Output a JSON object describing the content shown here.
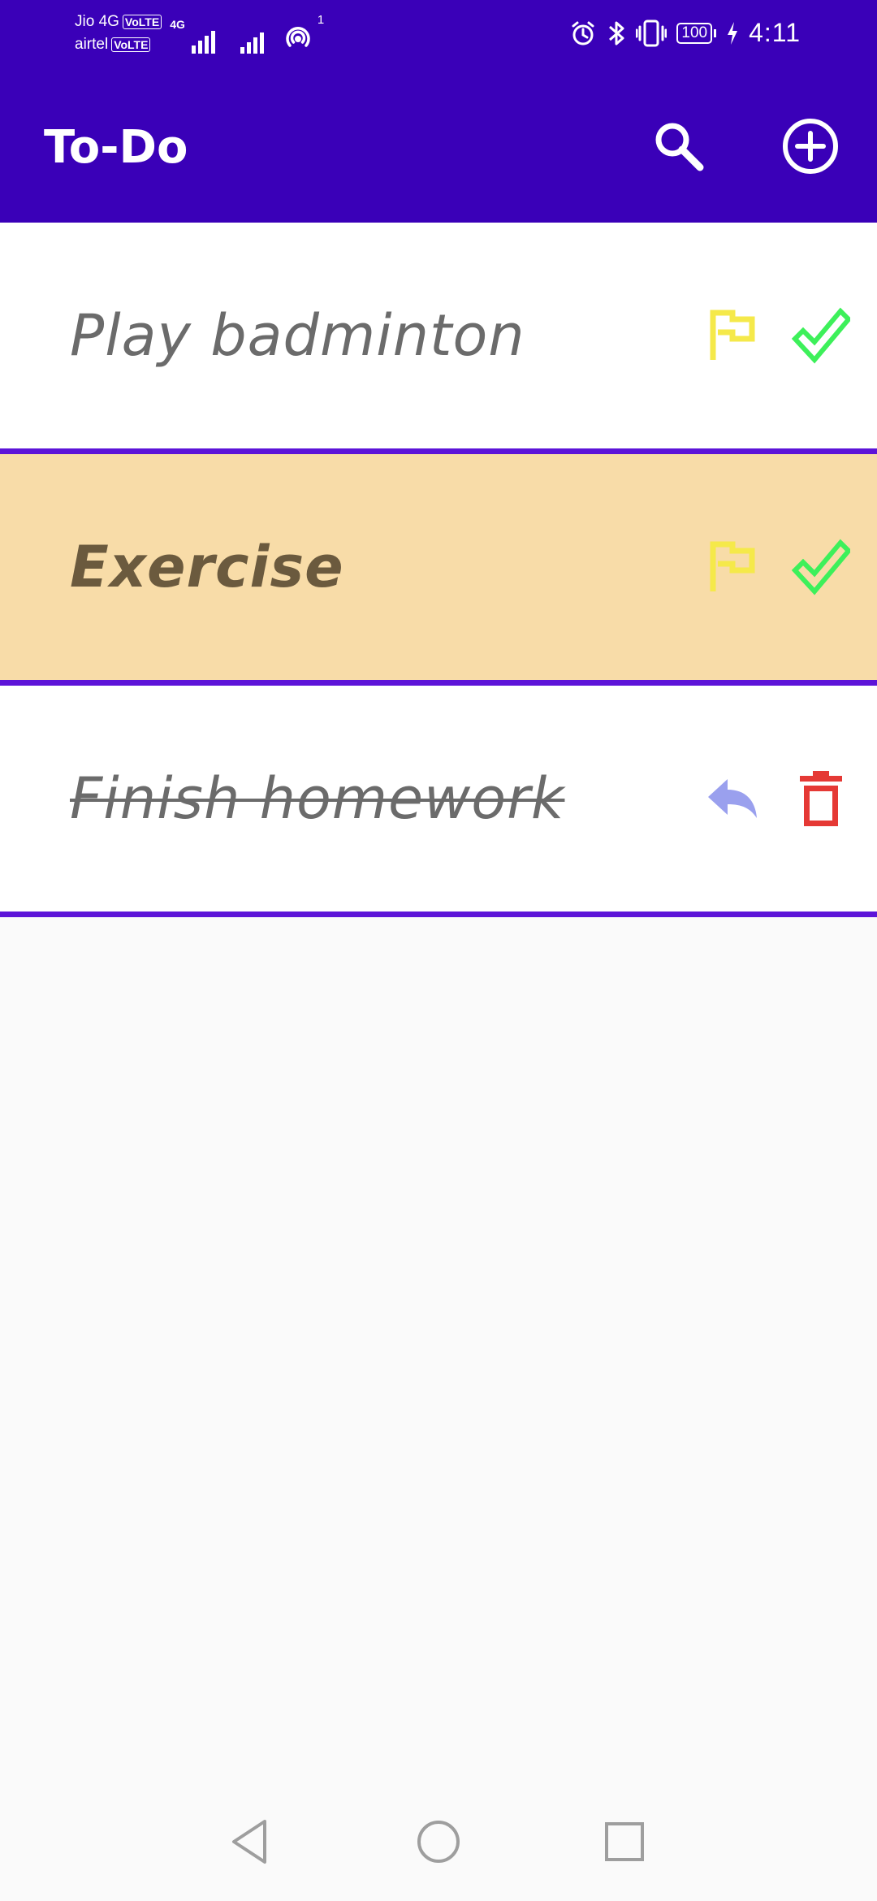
{
  "status_bar": {
    "carrier_1": "Jio 4G",
    "carrier_1_badge": "VoLTE",
    "carrier_2": "airtel",
    "carrier_2_badge": "VoLTE",
    "network_tag": "4G",
    "hotspot_count": "1",
    "battery_level": "100",
    "time": "4:11",
    "icons": [
      "alarm-icon",
      "bluetooth-icon",
      "vibrate-icon",
      "battery-icon",
      "charging-icon"
    ]
  },
  "app_bar": {
    "title": "To-Do",
    "background_color": "#3a00b8",
    "actions": [
      "search-icon",
      "add-circle-icon"
    ]
  },
  "tasks": [
    {
      "text": "Play badminton",
      "state": "pending",
      "highlighted": false,
      "actions": [
        "flag-icon",
        "check-icon"
      ]
    },
    {
      "text": "Exercise",
      "state": "pending",
      "highlighted": true,
      "actions": [
        "flag-icon",
        "check-icon"
      ]
    },
    {
      "text": "Finish homework",
      "state": "completed",
      "highlighted": false,
      "actions": [
        "undo-icon",
        "trash-icon"
      ]
    }
  ],
  "colors": {
    "divider": "#5d14d8",
    "highlight_row": "#f8dca8",
    "flag": "#f5e94a",
    "check": "#3df05a",
    "undo": "#9aa0ee",
    "trash": "#e53935"
  },
  "nav_bar": {
    "buttons": [
      "back-icon",
      "home-icon",
      "recents-icon"
    ]
  }
}
